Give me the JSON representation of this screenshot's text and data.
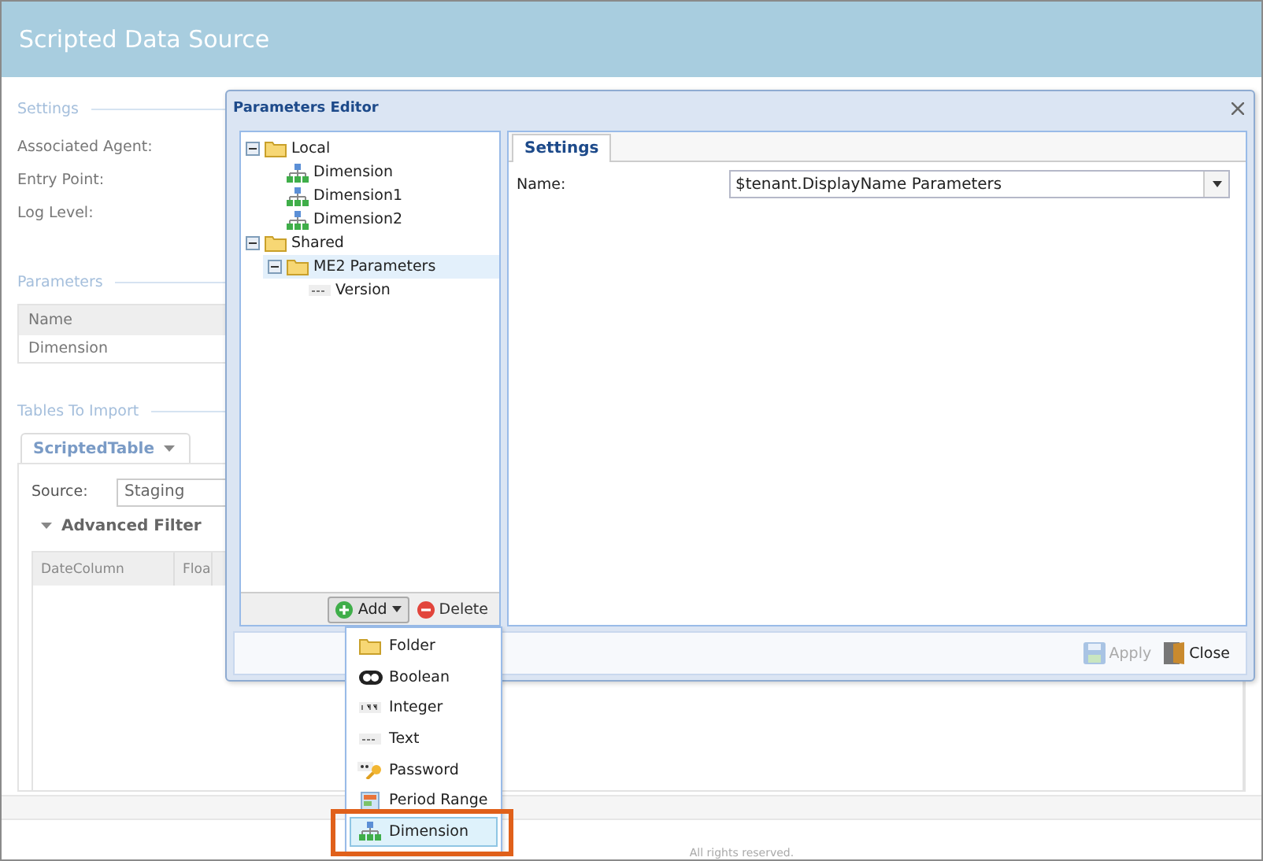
{
  "page": {
    "title": "Scripted Data Source",
    "footer": "All rights reserved."
  },
  "settings": {
    "heading": "Settings",
    "labels": [
      "Associated Agent:",
      "Entry Point:",
      "Log Level:"
    ]
  },
  "parameters": {
    "heading": "Parameters",
    "columns": [
      "Name"
    ],
    "rows": [
      "Dimension"
    ]
  },
  "tables_to_import": {
    "heading": "Tables To Import",
    "tab": "ScriptedTable",
    "source_label": "Source:",
    "source_value": "Staging",
    "advanced_filter": "Advanced Filter",
    "grid_columns": [
      "DateColumn",
      "Floa"
    ]
  },
  "dialog": {
    "title": "Parameters Editor",
    "tree": [
      {
        "label": "Local",
        "kind": "folder",
        "expanded": true,
        "selected": false,
        "children": [
          {
            "label": "Dimension",
            "kind": "dimension",
            "selected": false
          },
          {
            "label": "Dimension1",
            "kind": "dimension",
            "selected": false
          },
          {
            "label": "Dimension2",
            "kind": "dimension",
            "selected": false
          }
        ]
      },
      {
        "label": "Shared",
        "kind": "folder",
        "expanded": true,
        "selected": false,
        "children": [
          {
            "label": "ME2 Parameters",
            "kind": "folder",
            "expanded": true,
            "selected": true,
            "children": [
              {
                "label": "Version",
                "kind": "text",
                "selected": false
              }
            ]
          }
        ]
      }
    ],
    "add_button": "Add",
    "delete_button": "Delete",
    "tabs": [
      {
        "label": "Settings",
        "selected": true
      }
    ],
    "name_label": "Name:",
    "name_value": "$tenant.DisplayName Parameters",
    "buttons": [
      {
        "label": "Apply",
        "kind": "save",
        "disabled": true
      },
      {
        "label": "Close",
        "kind": "door",
        "disabled": false
      }
    ]
  },
  "add_menu": [
    {
      "label": "Folder",
      "kind": "folder",
      "highlighted": false
    },
    {
      "label": "Boolean",
      "kind": "boolean",
      "highlighted": false
    },
    {
      "label": "Integer",
      "kind": "integer",
      "highlighted": false
    },
    {
      "label": "Text",
      "kind": "text",
      "highlighted": false
    },
    {
      "label": "Password",
      "kind": "password",
      "highlighted": false
    },
    {
      "label": "Period Range",
      "kind": "period",
      "highlighted": false
    },
    {
      "label": "Dimension",
      "kind": "dimension",
      "highlighted": true
    }
  ]
}
